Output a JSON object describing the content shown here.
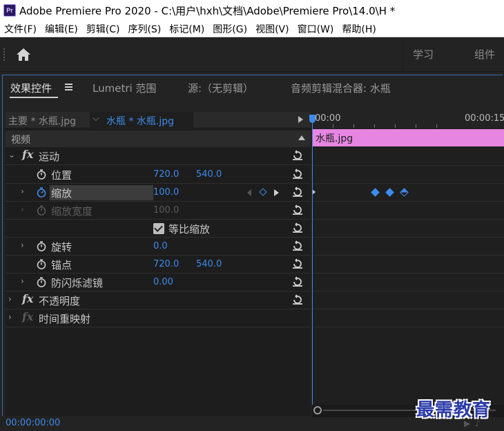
{
  "window": {
    "app_icon_text": "Pr",
    "title": "Adobe Premiere Pro 2020 - C:\\用户\\hxh\\文档\\Adobe\\Premiere Pro\\14.0\\H *"
  },
  "menu": [
    "文件(F)",
    "编辑(E)",
    "剪辑(C)",
    "序列(S)",
    "标记(M)",
    "图形(G)",
    "视图(V)",
    "窗口(W)",
    "帮助(H)"
  ],
  "workspaces": [
    "学习",
    "组件"
  ],
  "panel_tabs": [
    "效果控件",
    "Lumetri 范围",
    "源:（无剪辑）",
    "音频剪辑混合器: 水瓶"
  ],
  "clip_header": {
    "master": "主要 * 水瓶.jpg",
    "selected_clip": "水瓶 * 水瓶.jpg"
  },
  "section_label": "视频",
  "effects": {
    "motion": "运动",
    "opacity": "不透明度",
    "time_remap": "时间重映射"
  },
  "properties": {
    "position": {
      "label": "位置",
      "x": "720.0",
      "y": "540.0"
    },
    "scale": {
      "label": "缩放",
      "value": "100.0"
    },
    "scale_width": {
      "label": "缩放宽度",
      "value": "100.0"
    },
    "uniform_scale": {
      "label": "等比缩放",
      "checked": true
    },
    "rotation": {
      "label": "旋转",
      "value": "0.0"
    },
    "anchor": {
      "label": "锚点",
      "x": "720.0",
      "y": "540.0"
    },
    "anti_flicker": {
      "label": "防闪烁滤镜",
      "value": "0.00"
    }
  },
  "timeline": {
    "start": "00:00",
    "end": "00:00:15",
    "clip_name": "水瓶.jpg",
    "keyframe_count": 3
  },
  "timecode": "00:00:00:00",
  "watermark": "最需教育",
  "colors": {
    "accent": "#3d8bea",
    "clip": "#e686e2",
    "panel": "#232323"
  }
}
